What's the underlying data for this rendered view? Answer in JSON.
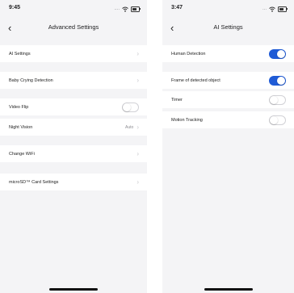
{
  "left": {
    "status": {
      "time": "9:45",
      "signal": "...."
    },
    "nav": {
      "title": "Advanced Settings"
    },
    "rows": {
      "ai_settings": "AI Settings",
      "baby_crying": "Baby Crying Detection",
      "video_flip": {
        "label": "Video Flip",
        "on": false
      },
      "night_vision": {
        "label": "Night Vision",
        "value": "Auto"
      },
      "change_wifi": "Change WiFi",
      "sd_card": "microSD™ Card Settings"
    }
  },
  "right": {
    "status": {
      "time": "3:47",
      "signal": "..."
    },
    "nav": {
      "title": "AI Settings"
    },
    "rows": {
      "human_detection": {
        "label": "Human Detection",
        "on": true
      },
      "frame_object": {
        "label": "Frame of detected object",
        "on": true
      },
      "timer": {
        "label": "Timer",
        "on": false
      },
      "motion_tracking": {
        "label": "Motion Tracking",
        "on": false
      }
    }
  },
  "colors": {
    "toggle_on": "#1f5bd6",
    "background": "#f4f4f6",
    "cell": "#ffffff"
  },
  "icons": {
    "back": "chevron-left-icon",
    "disclosure": "chevron-right-icon",
    "wifi": "wifi-icon",
    "battery": "battery-icon"
  }
}
